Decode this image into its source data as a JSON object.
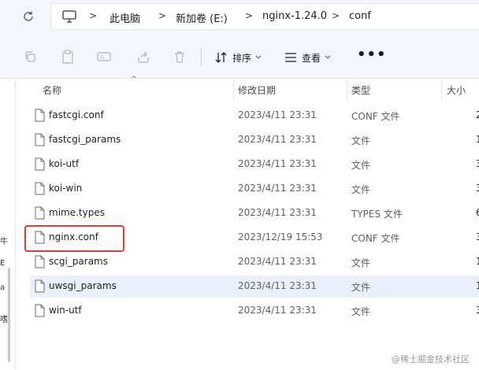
{
  "address": {
    "crumbs": [
      "此电脑",
      "新加卷 (E:)",
      "nginx-1.24.0",
      "conf"
    ]
  },
  "toolbar": {
    "sort_label": "排序",
    "view_label": "查看",
    "more_label": "•••",
    "icons": [
      "copy-icon",
      "paste-icon",
      "rename-icon",
      "share-icon",
      "delete-icon",
      "sort-icon",
      "view-icon",
      "more-icon"
    ]
  },
  "columns": {
    "name": "名称",
    "date": "修改日期",
    "type": "类型",
    "size": "大小"
  },
  "files": [
    {
      "name": "fastcgi.conf",
      "date": "2023/4/11 23:31",
      "type": "CONF 文件",
      "size": "2"
    },
    {
      "name": "fastcgi_params",
      "date": "2023/4/11 23:31",
      "type": "文件",
      "size": "1"
    },
    {
      "name": "koi-utf",
      "date": "2023/4/11 23:31",
      "type": "文件",
      "size": "3"
    },
    {
      "name": "koi-win",
      "date": "2023/4/11 23:31",
      "type": "文件",
      "size": "3"
    },
    {
      "name": "mime.types",
      "date": "2023/4/11 23:31",
      "type": "TYPES 文件",
      "size": "6"
    },
    {
      "name": "nginx.conf",
      "date": "2023/12/19 15:53",
      "type": "CONF 文件",
      "size": "3"
    },
    {
      "name": "scgi_params",
      "date": "2023/4/11 23:31",
      "type": "文件",
      "size": "1"
    },
    {
      "name": "uwsgi_params",
      "date": "2023/4/11 23:31",
      "type": "文件",
      "size": "1"
    },
    {
      "name": "win-utf",
      "date": "2023/4/11 23:31",
      "type": "文件",
      "size": "3"
    }
  ],
  "nav_chars": [
    "牛",
    "E",
    "a",
    "嗜"
  ],
  "watermark": "@稀土掘金技术社区",
  "colors": {
    "highlight": "#e53935",
    "selected_row": "#e8f1fb"
  }
}
